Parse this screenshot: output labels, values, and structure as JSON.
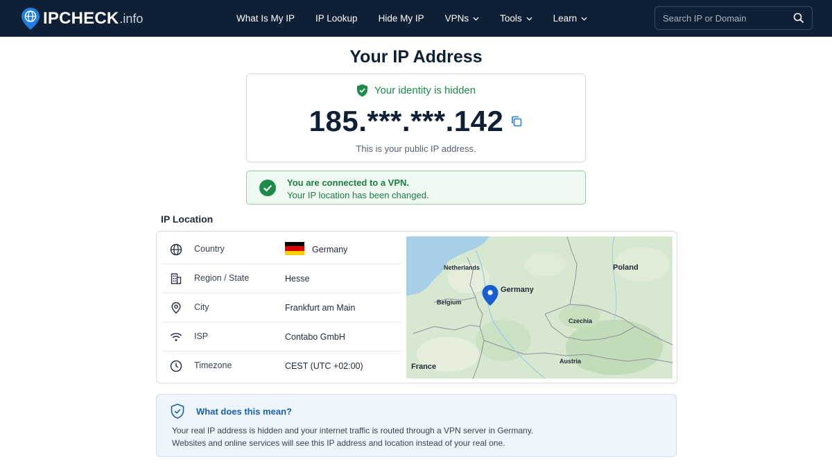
{
  "header": {
    "logo_main": "IPCHECK",
    "logo_suffix": ".info",
    "nav": [
      {
        "label": "What Is My IP"
      },
      {
        "label": "IP Lookup"
      },
      {
        "label": "Hide My IP"
      },
      {
        "label": "VPNs"
      },
      {
        "label": "Tools"
      },
      {
        "label": "Learn"
      }
    ],
    "search_placeholder": "Search IP or Domain"
  },
  "page_title": "Your IP Address",
  "ip_card": {
    "status": "Your identity is hidden",
    "ip": "185.***.***.142",
    "note": "This is your public IP address."
  },
  "vpn_banner": {
    "title": "You are connected to a VPN.",
    "subtitle": "Your IP location has been changed."
  },
  "location": {
    "section_title": "IP Location",
    "rows": [
      {
        "icon": "globe-icon",
        "label": "Country",
        "value": "Germany"
      },
      {
        "icon": "building-icon",
        "label": "Region / State",
        "value": "Hesse"
      },
      {
        "icon": "location-pin-icon",
        "label": "City",
        "value": "Frankfurt am Main"
      },
      {
        "icon": "wifi-icon",
        "label": "ISP",
        "value": "Contabo GmbH"
      },
      {
        "icon": "clock-icon",
        "label": "Timezone",
        "value": "CEST (UTC +02:00)"
      }
    ],
    "map_labels": {
      "netherlands": "Netherlands",
      "poland": "Poland",
      "germany": "Germany",
      "belgium": "Belgium",
      "czechia": "Czechia",
      "austria": "Austria",
      "france": "France"
    }
  },
  "info_box": {
    "title": "What does this mean?",
    "line1": "Your real IP address is hidden and your internet traffic is routed through a VPN server in Germany.",
    "line2": "Websites and online services will see this IP address and location instead of your real one."
  },
  "colors": {
    "header_bg": "#0e1f36",
    "success": "#1e8a4a",
    "info": "#1b5fa8"
  }
}
